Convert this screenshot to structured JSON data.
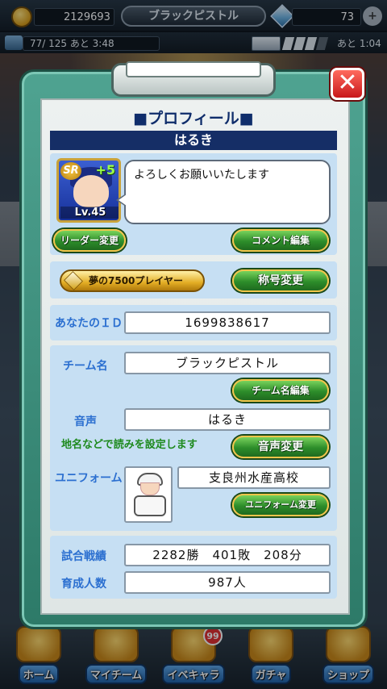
{
  "topbar": {
    "coins": "2129693",
    "team_title": "ブラックピストル",
    "gems": "73",
    "plus": "+"
  },
  "subbar": {
    "stamina": "77/ 125 あと  3:48",
    "ticket_time": "あと 1:04"
  },
  "profile": {
    "title": "■プロフィール■",
    "player_name": "はるき",
    "card": {
      "rarity": "SR",
      "plus": "+5",
      "level": "Lv.45"
    },
    "comment": "よろしくお願いいたします",
    "leader_change": "リーダー変更",
    "comment_edit": "コメント編集",
    "title_badge": "夢の7500プレイヤー",
    "title_change": "称号変更",
    "id_label": "あなたのＩＤ",
    "id_value": "1699838617",
    "team_label": "チーム名",
    "team_value": "ブラックピストル",
    "team_edit": "チーム名編集",
    "voice_label": "音声",
    "voice_value": "はるき",
    "voice_hint": "地名などで読みを設定します",
    "voice_change": "音声変更",
    "uniform_label": "ユニフォーム",
    "uniform_value": "支良州水産高校",
    "uniform_change": "ユニフォーム変更",
    "record_label": "試合戦績",
    "record_value": "2282勝　401敗　208分",
    "trained_label": "育成人数",
    "trained_value": "987人",
    "close": "✕"
  },
  "nav": [
    {
      "label": "ホーム"
    },
    {
      "label": "マイチーム"
    },
    {
      "label": "イベキャラ",
      "badge": "99"
    },
    {
      "label": "ガチャ"
    },
    {
      "label": "ショップ"
    }
  ]
}
